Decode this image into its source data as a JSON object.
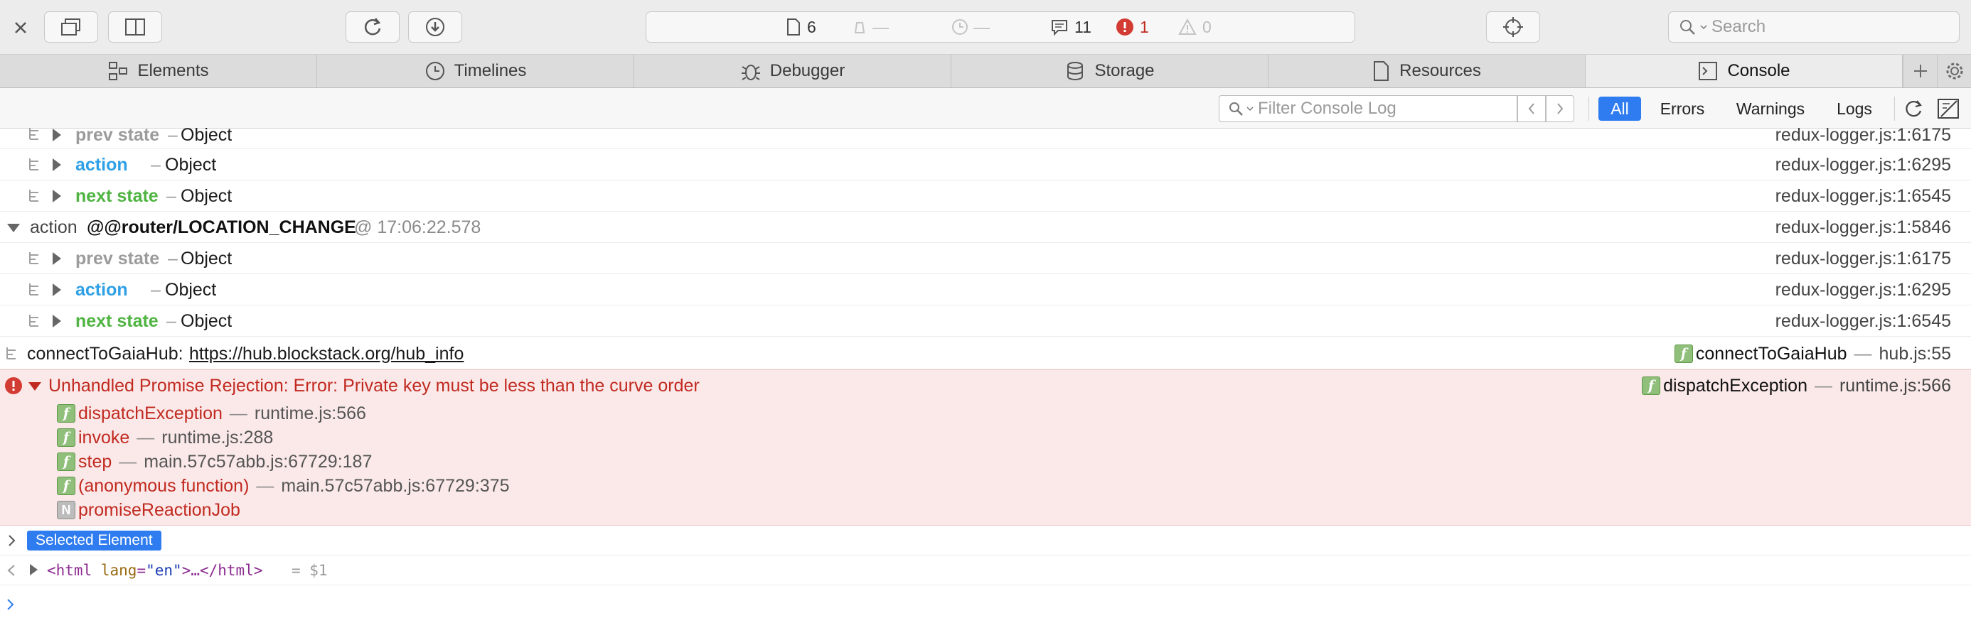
{
  "toolbar": {
    "resources_count": "6",
    "network_dash": "—",
    "time_dash": "—",
    "messages_count": "11",
    "errors_count": "1",
    "warnings_count": "0",
    "search_placeholder": "Search"
  },
  "tabs": [
    {
      "label": "Elements"
    },
    {
      "label": "Timelines"
    },
    {
      "label": "Debugger"
    },
    {
      "label": "Storage"
    },
    {
      "label": "Resources"
    },
    {
      "label": "Console"
    }
  ],
  "filter": {
    "placeholder": "Filter Console Log",
    "scopes": [
      "All",
      "Errors",
      "Warnings",
      "Logs"
    ],
    "active_scope": "All"
  },
  "console": {
    "group1": [
      {
        "label": "prev state",
        "sep": "–",
        "value": "Object",
        "source": "redux-logger.js:1:6175"
      },
      {
        "label": "action",
        "sep": "–",
        "value": "Object",
        "source": "redux-logger.js:1:6295"
      },
      {
        "label": "next state",
        "sep": "–",
        "value": "Object",
        "source": "redux-logger.js:1:6545"
      }
    ],
    "action_header": {
      "prefix": "action",
      "type": "@@router/LOCATION_CHANGE",
      "time": "@ 17:06:22.578",
      "source": "redux-logger.js:1:5846"
    },
    "group2": [
      {
        "label": "prev state",
        "sep": "–",
        "value": "Object",
        "source": "redux-logger.js:1:6175"
      },
      {
        "label": "action",
        "sep": "–",
        "value": "Object",
        "source": "redux-logger.js:1:6295"
      },
      {
        "label": "next state",
        "sep": "–",
        "value": "Object",
        "source": "redux-logger.js:1:6545"
      }
    ],
    "log": {
      "text": "connectToGaiaHub:",
      "link": "https://hub.blockstack.org/hub_info",
      "source_fn": "connectToGaiaHub",
      "source_file": "hub.js:55"
    },
    "error": {
      "message": "Unhandled Promise Rejection: Error: Private key must be less than the curve order",
      "source_fn": "dispatchException",
      "source_file": "runtime.js:566",
      "frames": [
        {
          "badge": "f",
          "fn": "dispatchException",
          "loc": "runtime.js:566"
        },
        {
          "badge": "f",
          "fn": "invoke",
          "loc": "runtime.js:288"
        },
        {
          "badge": "f",
          "fn": "step",
          "loc": "main.57c57abb.js:67729:187"
        },
        {
          "badge": "f",
          "fn": "(anonymous function)",
          "loc": "main.57c57abb.js:67729:375"
        },
        {
          "badge": "N",
          "fn": "promiseReactionJob",
          "loc": ""
        }
      ]
    },
    "selected_element_label": "Selected Element",
    "html_open": "<html",
    "html_attr": "lang",
    "html_val": "\"en\"",
    "html_close": ">…</html>",
    "html_var": "= $1"
  },
  "colors": {
    "accent": "#2f7cf0",
    "prev_state": "#9b9b9b",
    "action": "#2fa0e6",
    "next_state": "#4fb441",
    "error_text": "#c12a20",
    "error_bg": "#fbe9e9"
  }
}
